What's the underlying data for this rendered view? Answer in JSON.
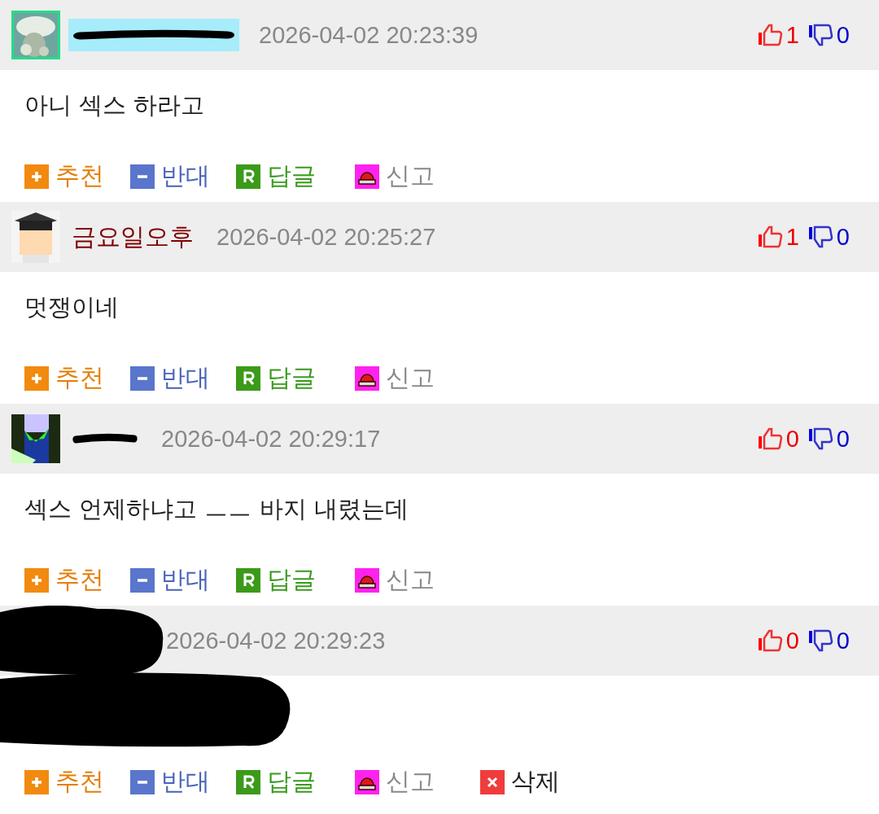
{
  "comments": [
    {
      "kind": "redacted",
      "highlighted": true,
      "timestamp": "2026-04-02 20:23:39",
      "likes": "1",
      "dislikes": "0",
      "text": "아니 섹스 하라고",
      "actions": [
        {
          "kind": "recommend",
          "label": "추천"
        },
        {
          "kind": "oppose",
          "label": "반대"
        },
        {
          "kind": "reply",
          "label": "답글"
        },
        {
          "kind": "report",
          "label": "신고"
        }
      ]
    },
    {
      "kind": "named",
      "author": "금요일오후",
      "highlighted": false,
      "timestamp": "2026-04-02 20:25:27",
      "likes": "1",
      "dislikes": "0",
      "text": "멋쟁이네",
      "actions": [
        {
          "kind": "recommend",
          "label": "추천"
        },
        {
          "kind": "oppose",
          "label": "반대"
        },
        {
          "kind": "reply",
          "label": "답글"
        },
        {
          "kind": "report",
          "label": "신고"
        }
      ]
    },
    {
      "kind": "redacted",
      "highlighted": false,
      "timestamp": "2026-04-02 20:29:17",
      "likes": "0",
      "dislikes": "0",
      "text": "섹스 언제하냐고 ㅡㅡ 바지 내렸는데",
      "actions": [
        {
          "kind": "recommend",
          "label": "추천"
        },
        {
          "kind": "oppose",
          "label": "반대"
        },
        {
          "kind": "reply",
          "label": "답글"
        },
        {
          "kind": "report",
          "label": "신고"
        }
      ]
    },
    {
      "kind": "hidden",
      "timestamp": "2026-04-02 20:29:23",
      "likes": "0",
      "dislikes": "0",
      "actions": [
        {
          "kind": "recommend",
          "label": "추천"
        },
        {
          "kind": "oppose",
          "label": "반대"
        },
        {
          "kind": "reply",
          "label": "답글"
        },
        {
          "kind": "report",
          "label": "신고"
        },
        {
          "kind": "delete",
          "label": "삭제"
        }
      ]
    }
  ]
}
